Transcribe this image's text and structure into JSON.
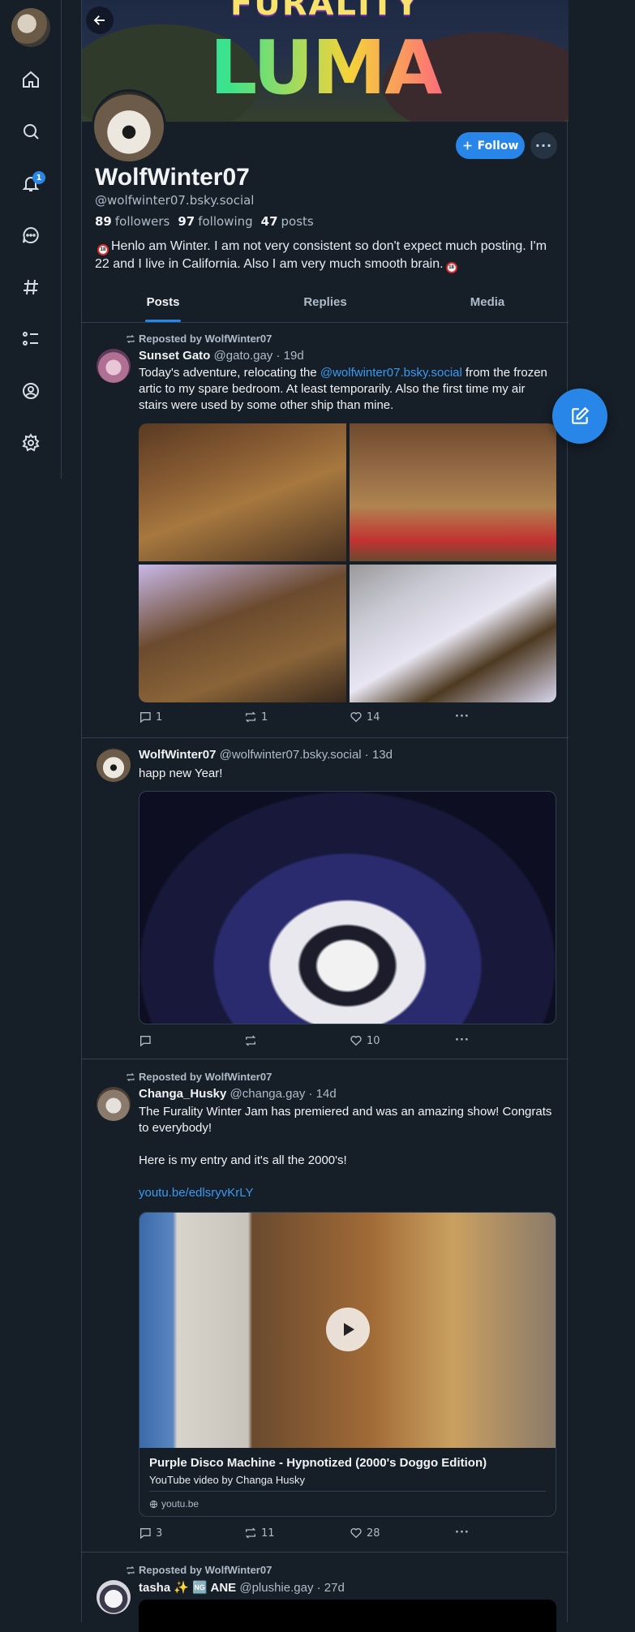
{
  "nav": {
    "items": [
      "home-icon",
      "search-icon",
      "bell-icon",
      "chat-icon",
      "hashtag-icon",
      "list-icon",
      "profile-icon",
      "gear-icon"
    ],
    "notification_count": "1"
  },
  "banner": {
    "top_text": "FURALITY",
    "title": "LUMA"
  },
  "profile": {
    "display_name": "WolfWinter07",
    "handle": "@wolfwinter07.bsky.social",
    "followers_count": "89",
    "followers_label": "followers",
    "following_count": "97",
    "following_label": "following",
    "posts_count": "47",
    "posts_label": "posts",
    "bio": "Henlo am Winter. I am not very consistent so don't expect much posting. I'm 22 and I live in California. Also I am very much smooth brain.",
    "follow_label": "Follow"
  },
  "tabs": [
    "Posts",
    "Replies",
    "Media"
  ],
  "posts": [
    {
      "repost_label": "Reposted by WolfWinter07",
      "author": "Sunset Gato",
      "handle": "@gato.gay",
      "age": "· 19d",
      "text_before": "Today's adventure, relocating the ",
      "mention": "@wolfwinter07.bsky.social",
      "text_after": " from the frozen artic to my spare bedroom. At least temporarily. Also the first time my air stairs were used by some other ship than mine.",
      "replies": "1",
      "reposts": "1",
      "likes": "14"
    },
    {
      "author": "WolfWinter07",
      "handle": "@wolfwinter07.bsky.social",
      "age": "· 13d",
      "text": "happ new Year!",
      "replies": "",
      "reposts": "",
      "likes": "10"
    },
    {
      "repost_label": "Reposted by WolfWinter07",
      "author": "Changa_Husky",
      "handle": "@changa.gay",
      "age": "· 14d",
      "line1": "The Furality Winter Jam has premiered and was an amazing show! Congrats to everybody!",
      "line2": "Here is my entry and it's all the 2000's!",
      "link": "youtu.be/edlsryvKrLY",
      "embed_title": "Purple Disco Machine - Hypnotized (2000's Doggo Edition)",
      "embed_desc": "YouTube video by Changa Husky",
      "embed_domain": "youtu.be",
      "replies": "3",
      "reposts": "11",
      "likes": "28"
    },
    {
      "repost_label": "Reposted by WolfWinter07",
      "author": "tasha",
      "author_suffix": "✨ 🆖 ANE",
      "handle": "@plushie.gay",
      "age": "· 27d"
    }
  ]
}
